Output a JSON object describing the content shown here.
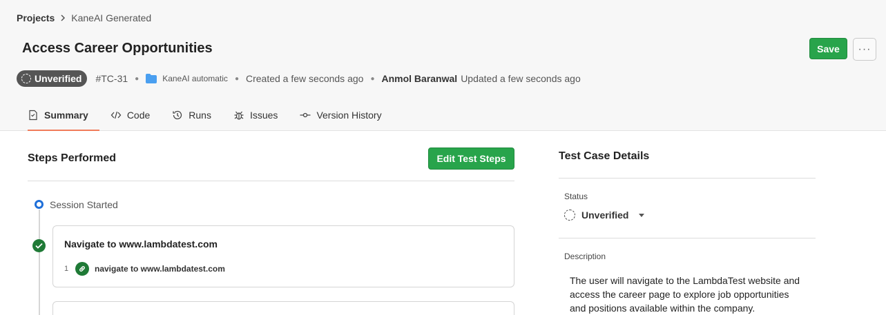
{
  "breadcrumb": {
    "root": "Projects",
    "current": "KaneAI Generated"
  },
  "title": "Access Career Opportunities",
  "actions": {
    "save_label": "Save",
    "more_label": "···"
  },
  "meta": {
    "status_badge": "Unverified",
    "test_id": "#TC-31",
    "folder": "KaneAI automatic",
    "created": "Created a few seconds ago",
    "author": "Anmol Baranwal",
    "updated": "Updated a few seconds ago",
    "folder_color": "#4a9ff0"
  },
  "tabs": [
    {
      "label": "Summary",
      "icon": "summary-icon",
      "active": true
    },
    {
      "label": "Code",
      "icon": "code-icon",
      "active": false
    },
    {
      "label": "Runs",
      "icon": "history-icon",
      "active": false
    },
    {
      "label": "Issues",
      "icon": "bug-icon",
      "active": false
    },
    {
      "label": "Version History",
      "icon": "commit-icon",
      "active": false
    }
  ],
  "steps_panel": {
    "heading": "Steps Performed",
    "edit_label": "Edit Test Steps",
    "session_label": "Session Started",
    "steps": [
      {
        "title": "Navigate to www.lambdatest.com",
        "sub_number": "1",
        "sub_text": "navigate to www.lambdatest.com"
      }
    ]
  },
  "details_panel": {
    "heading": "Test Case Details",
    "status_label": "Status",
    "status_value": "Unverified",
    "description_label": "Description",
    "description": "The user will navigate to the LambdaTest website and access the career page to explore job opportunities and positions available within the company."
  },
  "colors": {
    "accent_green": "#28a44b",
    "tab_underline": "#f07b5a",
    "session_dot": "#1e6fd9",
    "step_check": "#1f7a36"
  }
}
